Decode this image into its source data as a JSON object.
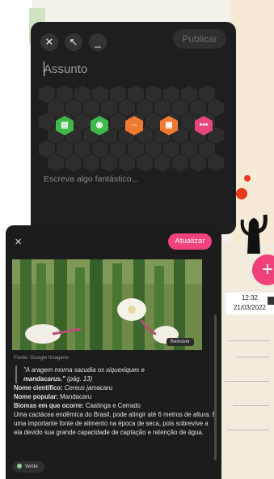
{
  "composer": {
    "close_label": "✕",
    "minimize_label": "⇱",
    "collapse_label": "—",
    "publish_label": "Publicar",
    "subject_placeholder": "Assunto",
    "body_placeholder": "Escreva algo fantástico...",
    "attach_icons": [
      "document-icon",
      "camera-icon",
      "link-icon",
      "image-icon",
      "more-icon"
    ],
    "colors": {
      "document": "#3fb94a",
      "camera": "#3fb94a",
      "link": "#f07a2f",
      "image": "#f07a2f",
      "more": "#e8457f"
    }
  },
  "modal": {
    "close_label": "✕",
    "update_label": "Atualizar",
    "remove_label": "Remover",
    "source": "Fonte: Google Imagens",
    "quote_text": "\"A aragem morna sacudia os xiquexiques e",
    "quote_bold": "mandacarus.\"",
    "quote_page": " (pág. 13)",
    "sci_label": "Nome científico:",
    "sci_value": " Cereus jamacaru",
    "pop_label": "Nome popular:",
    "pop_value": " Mandacaru",
    "biome_label": "Biomas em que ocorre:",
    "biome_value": " Caatinga e Cerrado",
    "description": "Uma cactácea endêmica do Brasil, pode atingir até 6 metros de altura. É uma importante fonte de alimento na época de seca, pois sobrevive a ela devido sua grande capacidade de captação e retenção de água.",
    "tag_label": "Verde"
  },
  "taskbar": {
    "time": "12:32",
    "date": "21/03/2022"
  },
  "fab_label": "+"
}
